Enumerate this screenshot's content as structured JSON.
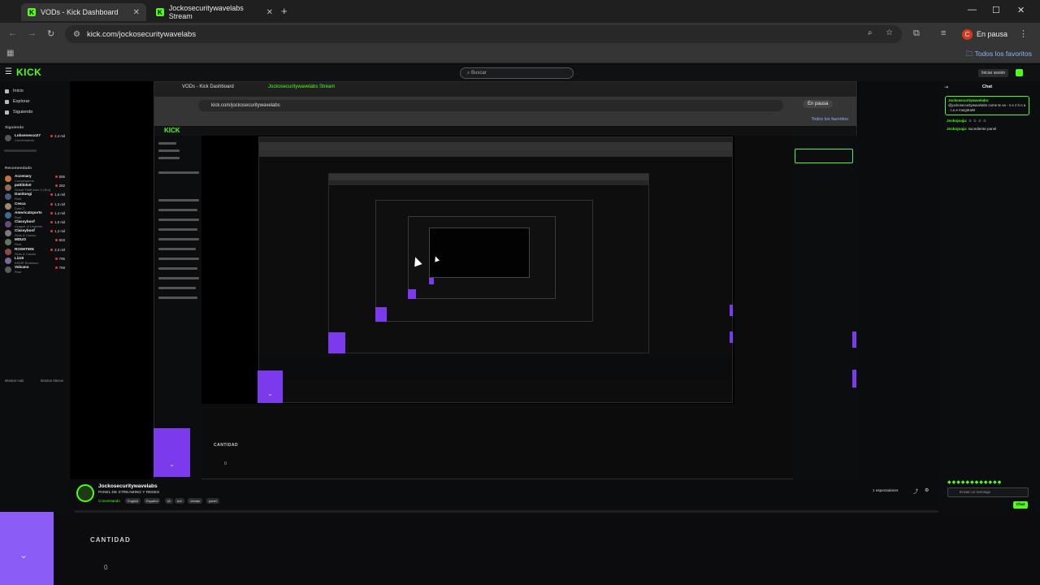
{
  "browser": {
    "tabs": [
      {
        "label": "VODs - Kick Dashboard"
      },
      {
        "label": "Jockosecuritywavelabs Stream"
      }
    ],
    "url": "kick.com/jockosecuritywavelabs",
    "profile_status": "En pausa",
    "profile_initial": "C",
    "bookmarks_label": "Todos los favoritos"
  },
  "kick": {
    "logo": "KICK",
    "search_placeholder": "Buscar",
    "login_label": "Iniciar sesión",
    "nav": [
      {
        "label": "Inicio"
      },
      {
        "label": "Explorar"
      },
      {
        "label": "Siguiendo"
      }
    ],
    "following_title": "Siguiendo",
    "following": [
      {
        "name": "Lobsenesco27",
        "category": "Conversando",
        "viewers": "2,4 mil"
      }
    ],
    "recommended_title": "Recomendado",
    "recommended": [
      {
        "name": "Accenary",
        "category": "Conversando",
        "viewers": "555"
      },
      {
        "name": "pattilolo0",
        "category": "Grand Theft Auto V (Rol)",
        "viewers": "282"
      },
      {
        "name": "Danitongi",
        "category": "Rust",
        "viewers": "1,6 mil"
      },
      {
        "name": "Cesca",
        "category": "Dota 2",
        "viewers": "1,3 mil"
      },
      {
        "name": "Americatsports",
        "category": "Rust",
        "viewers": "1,4 mil"
      },
      {
        "name": "Classyboof",
        "category": "League of Legends",
        "viewers": "1,0 mil"
      },
      {
        "name": "Classyboof",
        "category": "Slots & Casino",
        "viewers": "1,2 mil"
      },
      {
        "name": "MDUO",
        "category": "Rust",
        "viewers": "603"
      },
      {
        "name": "ROSHTEIN",
        "category": "Slots & Casino",
        "viewers": "2,3 mil"
      },
      {
        "name": "Lizz0",
        "category": "ASMR Realismo",
        "viewers": "795"
      },
      {
        "name": "Volcano",
        "category": "Rust",
        "viewers": "759"
      }
    ],
    "show_more": "Mostrar más",
    "show_less": "Mostrar Menos"
  },
  "stream": {
    "streamer": "Jockosecuritywavelabs",
    "title": "PANEL DE STREAMING Y REDES",
    "category": "Conversando",
    "tags": [
      "English",
      "Español",
      "IA",
      "bot",
      "Vantas",
      "panel"
    ],
    "viewers": "1 espectadores",
    "cantidad_label": "CANTIDAD",
    "cantidad_value": "0"
  },
  "chat": {
    "title": "Chat",
    "pinned_user": "Jockosecuritywavelabs:",
    "pinned_text": "@jockosecuritywavelabs come te va - n e z h n a . c.e.e meigiKaW",
    "messages": [
      {
        "user": "Jockojoaja:",
        "text": "☺ ☺ ☺ ☺"
      },
      {
        "user": "Jockojoaja:",
        "text": "sucediente panel"
      }
    ],
    "input_placeholder": "Enviar un mensaje",
    "send_label": "Chat"
  },
  "colors": {
    "brand_green": "#53fc18",
    "accent_purple": "#8b5cf6",
    "pause_red": "#d9381e"
  }
}
